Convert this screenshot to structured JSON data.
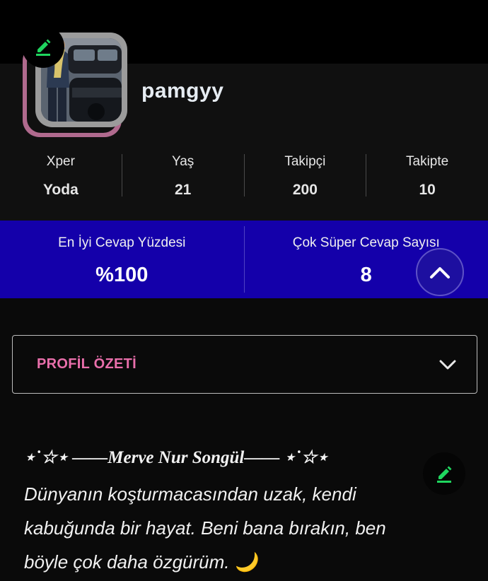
{
  "profile": {
    "username": "pamgyy",
    "avatar_alt": "profile photo",
    "edit_icon": "pencil-edit-icon"
  },
  "stats": [
    {
      "label": "Xper",
      "value": "Yoda"
    },
    {
      "label": "Yaş",
      "value": "21"
    },
    {
      "label": "Takipçi",
      "value": "200"
    },
    {
      "label": "Takipte",
      "value": "10"
    }
  ],
  "highlights": [
    {
      "label": "En İyi Cevap Yüzdesi",
      "value": "%100"
    },
    {
      "label": "Çok Süper Cevap Sayısı",
      "value": "8"
    }
  ],
  "summary": {
    "title": "PROFİL ÖZETİ",
    "heading": "⋆˙☆⋆ ——Merve Nur Songül—— ⋆˙☆⋆",
    "text": "Dünyanın koşturmacasından uzak, kendi kabuğunda bir hayat. Beni bana bırakın, ben böyle çok daha özgürüm. 🌙"
  },
  "colors": {
    "accent_blue": "#1400aa",
    "accent_pink": "#e96fab",
    "edit_green": "#1fd65f",
    "background": "#0a0a0a"
  },
  "icons": [
    "pencil-edit-icon",
    "chevron-up-icon",
    "chevron-down-icon"
  ]
}
